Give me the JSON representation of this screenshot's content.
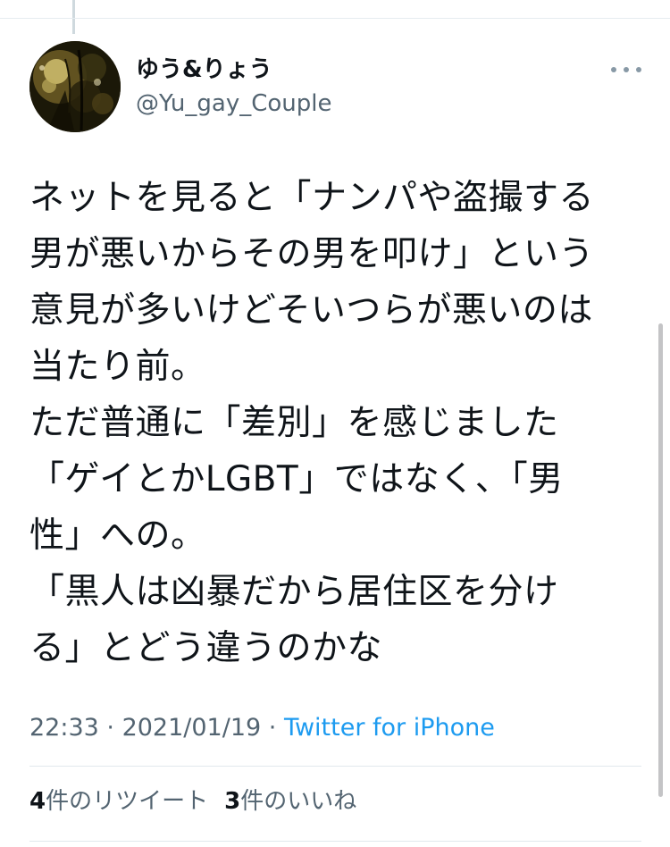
{
  "author": {
    "display_name": "ゆう&りょう",
    "handle": "@Yu_gay_Couple"
  },
  "tweet": {
    "lines": [
      "ネットを見ると「ナンパや盗撮する",
      "男が悪いからその男を叩け」という",
      "意見が多いけどそいつらが悪いのは",
      "当たり前。",
      "ただ普通に「差別」を感じました",
      "「ゲイとかLGBT」ではなく、「男",
      "性」への。",
      "「黒人は凶暴だから居住区を分け",
      "る」とどう違うのかな"
    ]
  },
  "meta": {
    "time": "22:33",
    "separator1": " · ",
    "date": "2021/01/19",
    "separator2": " · ",
    "source": "Twitter for iPhone"
  },
  "stats": {
    "retweets_count": "4",
    "retweets_label": "件のリツイート",
    "likes_count": "3",
    "likes_label": "件のいいね"
  },
  "icons": {
    "more": "more-horizontal-icon",
    "avatar": "profile-photo"
  },
  "colors": {
    "text": "#0f1419",
    "secondary": "#536471",
    "link": "#1d9bf0",
    "divider": "#e1e8ed"
  }
}
